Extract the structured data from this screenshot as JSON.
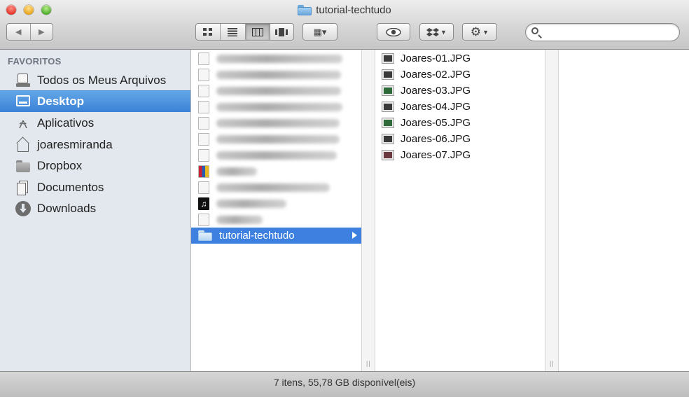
{
  "window": {
    "title": "tutorial-techtudo"
  },
  "toolbar": {
    "back_icon": "◀",
    "forward_icon": "▶",
    "view_modes": [
      "icon-view",
      "list-view",
      "column-view",
      "coverflow-view"
    ],
    "active_view": "column-view",
    "arrange_icon": "▦▾",
    "quicklook_icon": "👁",
    "dropbox_icon": "❖▾",
    "action_icon": "✲▾",
    "search_placeholder": ""
  },
  "sidebar": {
    "header": "FAVORITOS",
    "items": [
      {
        "label": "Todos os Meus Arquivos",
        "icon": "all-files-icon",
        "selected": false
      },
      {
        "label": "Desktop",
        "icon": "desktop-icon",
        "selected": true
      },
      {
        "label": "Aplicativos",
        "icon": "applications-icon",
        "selected": false
      },
      {
        "label": "joaresmiranda",
        "icon": "home-icon",
        "selected": false
      },
      {
        "label": "Dropbox",
        "icon": "folder-icon",
        "selected": false
      },
      {
        "label": "Documentos",
        "icon": "documents-icon",
        "selected": false
      },
      {
        "label": "Downloads",
        "icon": "downloads-icon",
        "selected": false
      }
    ]
  },
  "column1": {
    "selected_item": "tutorial-techtudo"
  },
  "column2": {
    "files": [
      "Joares-01.JPG",
      "Joares-02.JPG",
      "Joares-03.JPG",
      "Joares-04.JPG",
      "Joares-05.JPG",
      "Joares-06.JPG",
      "Joares-07.JPG"
    ]
  },
  "status": {
    "text": "7 itens, 55,78 GB disponível(eis)"
  }
}
